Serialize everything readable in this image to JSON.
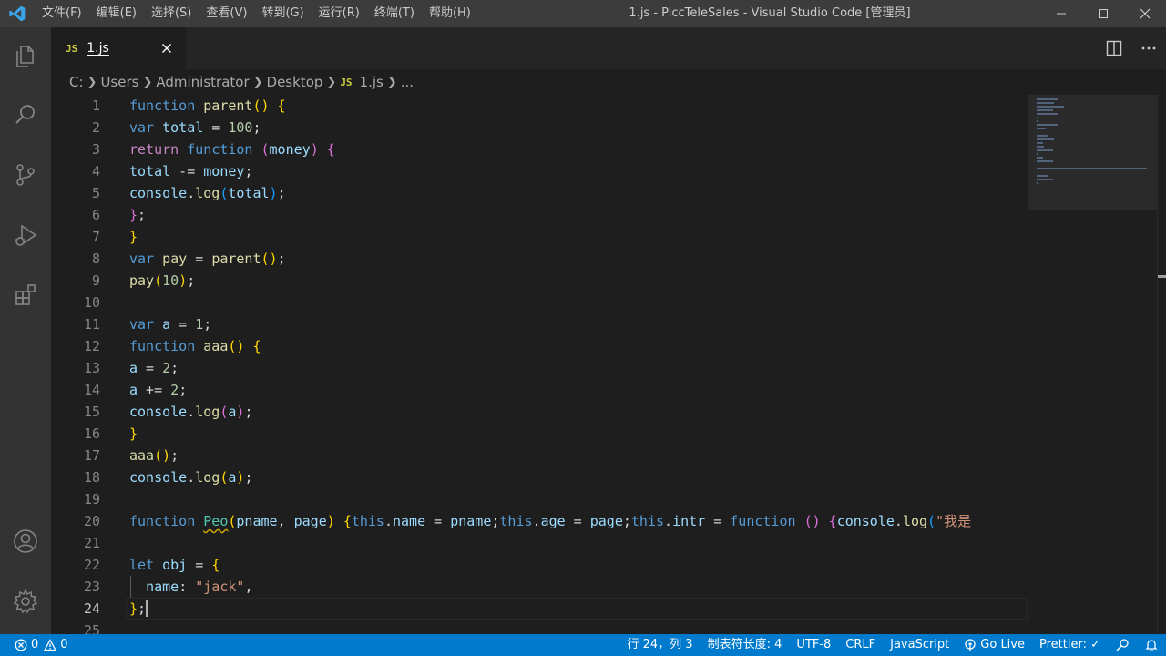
{
  "colors": {
    "accent": "#007acc",
    "titlebar": "#3c3c3c",
    "activitybar": "#333333",
    "editor_bg": "#1e1e1e"
  },
  "menu": [
    "文件(F)",
    "编辑(E)",
    "选择(S)",
    "查看(V)",
    "转到(G)",
    "运行(R)",
    "终端(T)",
    "帮助(H)"
  ],
  "window_title": "1.js - PiccTeleSales - Visual Studio Code [管理员]",
  "activity_icons": [
    "explorer-icon",
    "search-icon",
    "source-control-icon",
    "run-debug-icon",
    "extensions-icon",
    "account-icon",
    "settings-gear-icon"
  ],
  "tab": {
    "badge": "JS",
    "name": "1.js"
  },
  "breadcrumb": {
    "drive": "C:",
    "users": "Users",
    "admin": "Administrator",
    "desktop": "Desktop",
    "badge": "JS",
    "file": "1.js",
    "more": "..."
  },
  "editor": {
    "current_line": 24,
    "lines": [
      {
        "n": "1",
        "t": "function parent() {"
      },
      {
        "n": "2",
        "t": "var total = 100;"
      },
      {
        "n": "3",
        "t": "return function (money) {"
      },
      {
        "n": "4",
        "t": "total -= money;"
      },
      {
        "n": "5",
        "t": "console.log(total);"
      },
      {
        "n": "6",
        "t": "};"
      },
      {
        "n": "7",
        "t": "}"
      },
      {
        "n": "8",
        "t": "var pay = parent();"
      },
      {
        "n": "9",
        "t": "pay(10);"
      },
      {
        "n": "10",
        "t": ""
      },
      {
        "n": "11",
        "t": "var a = 1;"
      },
      {
        "n": "12",
        "t": "function aaa() {"
      },
      {
        "n": "13",
        "t": "a = 2;"
      },
      {
        "n": "14",
        "t": "a += 2;"
      },
      {
        "n": "15",
        "t": "console.log(a);"
      },
      {
        "n": "16",
        "t": "}"
      },
      {
        "n": "17",
        "t": "aaa();"
      },
      {
        "n": "18",
        "t": "console.log(a);"
      },
      {
        "n": "19",
        "t": ""
      },
      {
        "n": "20",
        "t": "function Peo(pname, page) {this.name = pname;this.age = page;this.intr = function () {console.log(\"我是"
      },
      {
        "n": "21",
        "t": ""
      },
      {
        "n": "22",
        "t": "let obj = {"
      },
      {
        "n": "23",
        "t": "  name: \"jack\","
      },
      {
        "n": "24",
        "t": "};"
      },
      {
        "n": "25",
        "t": ""
      }
    ]
  },
  "status": {
    "errors": "0",
    "warnings": "0",
    "position": "行 24，列 3",
    "tab_size": "制表符长度: 4",
    "encoding": "UTF-8",
    "eol": "CRLF",
    "language": "JavaScript",
    "go_live": "Go Live",
    "prettier": "Prettier: ✓"
  }
}
